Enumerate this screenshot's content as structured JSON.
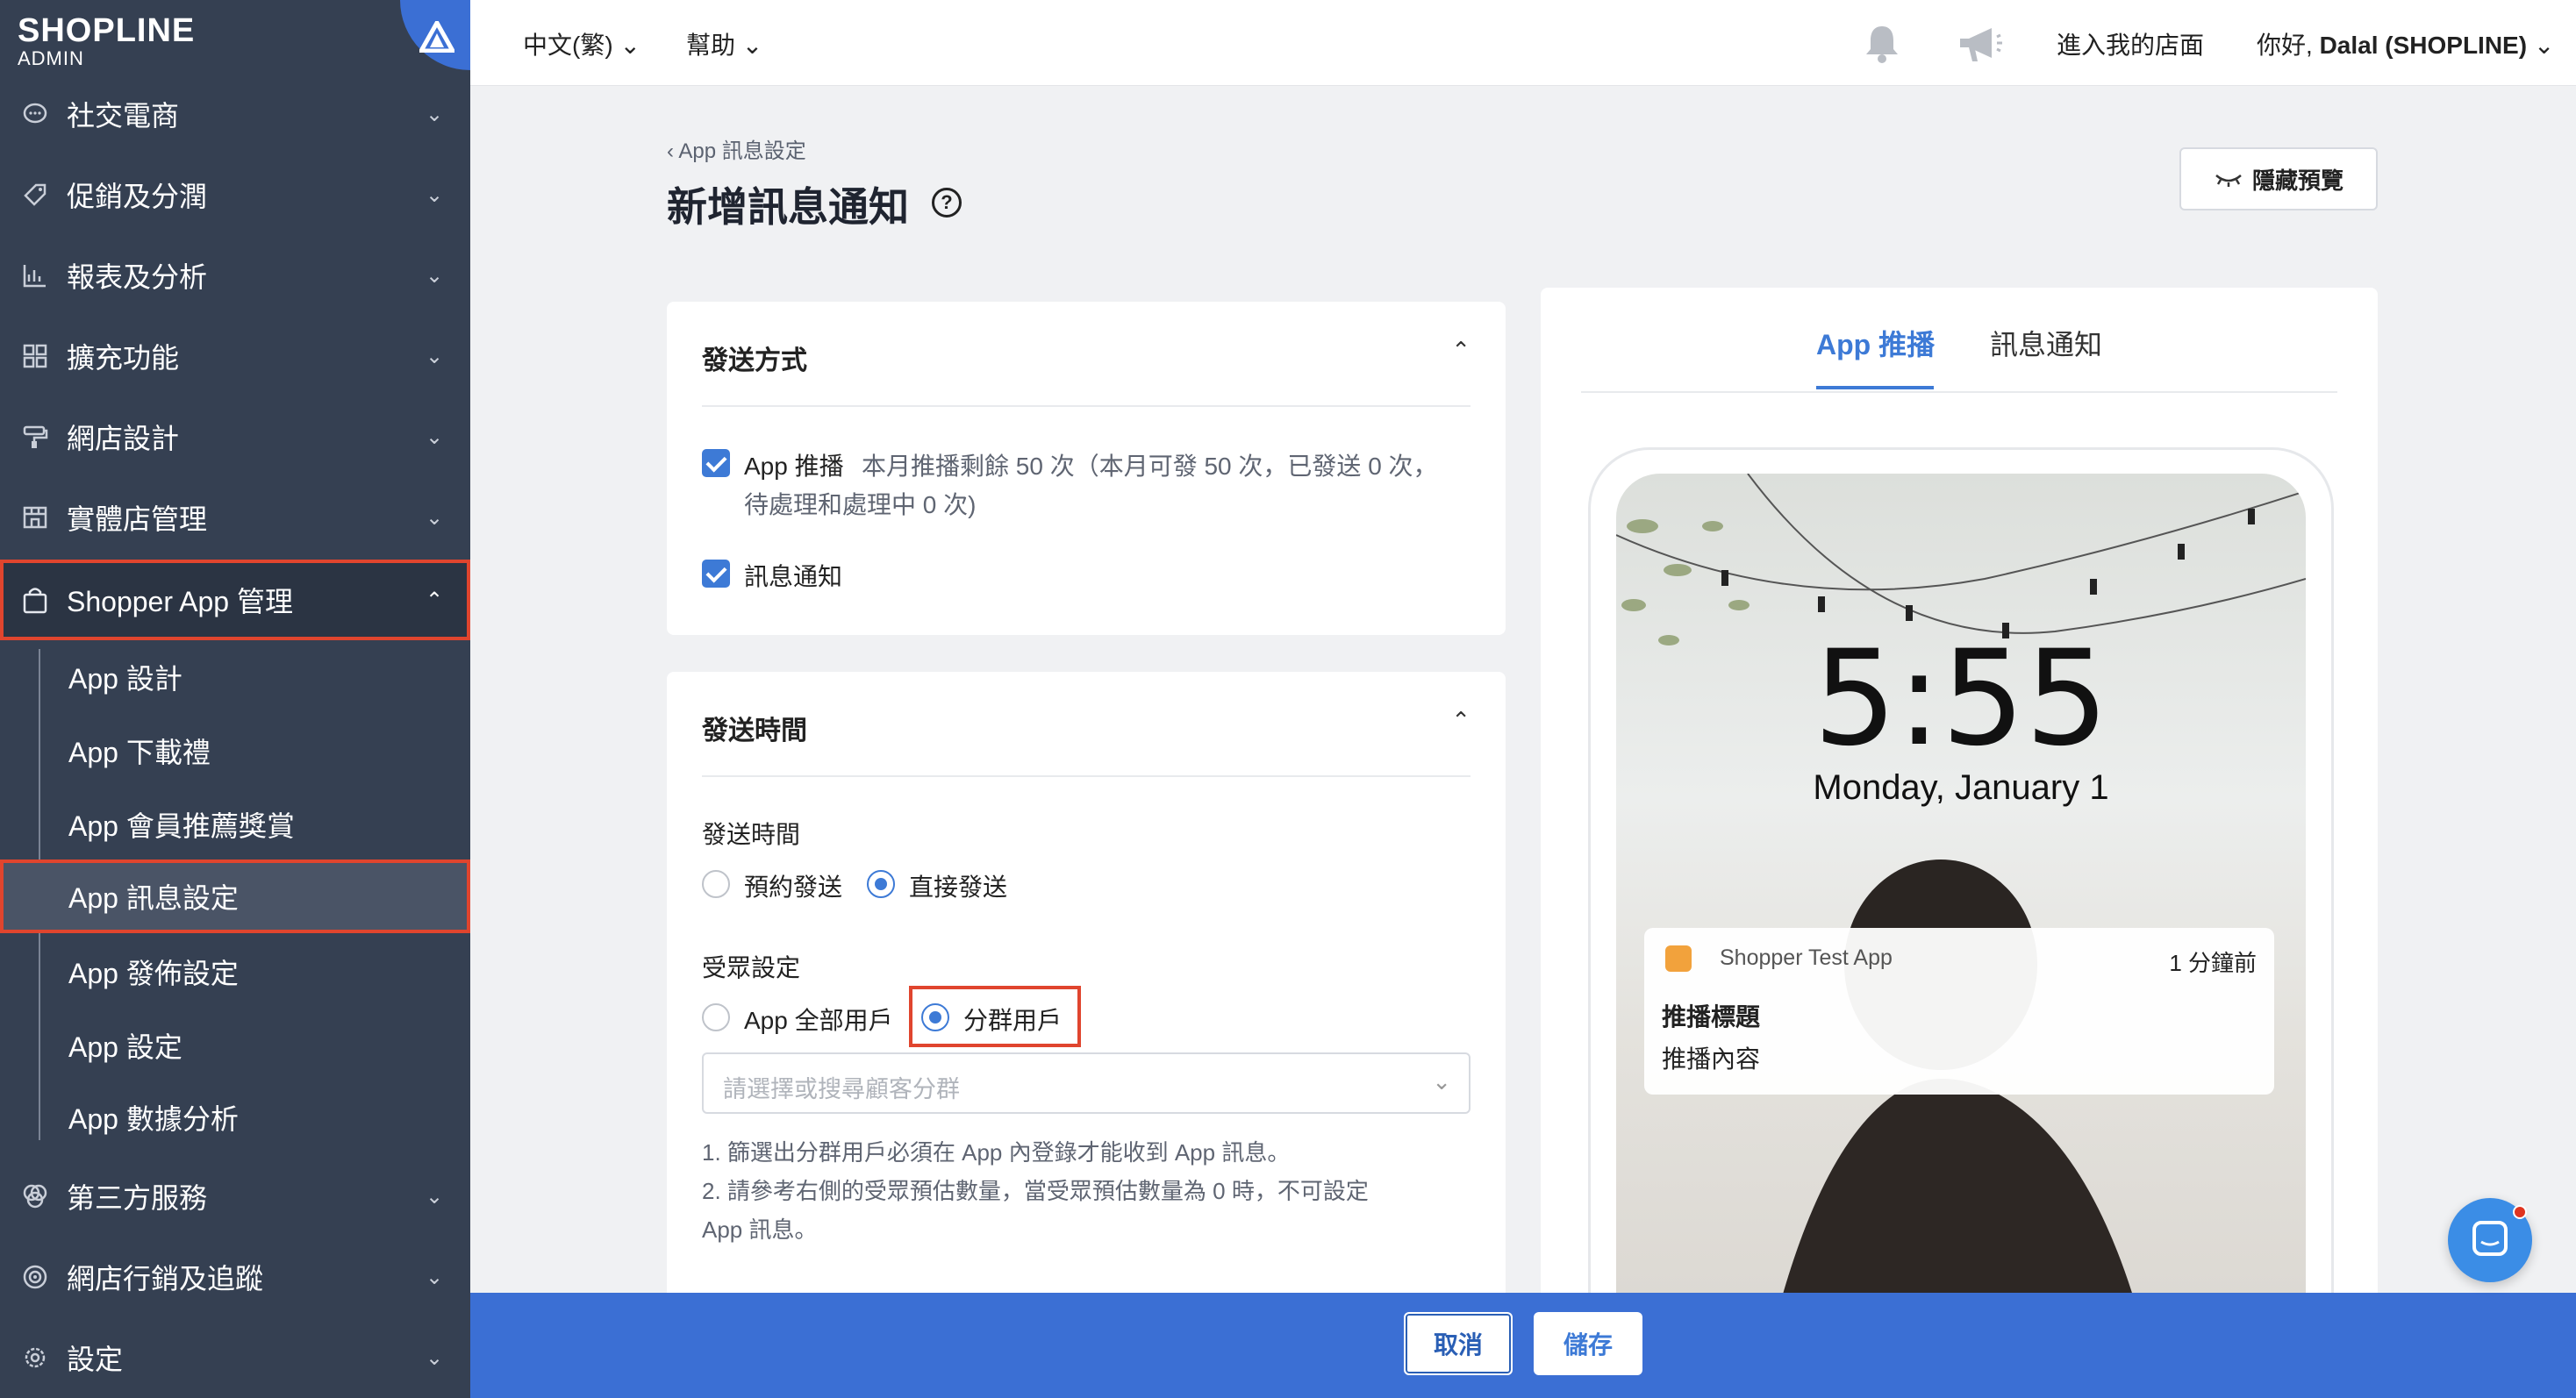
{
  "brand": {
    "logo": "SHOPLINE",
    "sub": "ADMIN"
  },
  "sidebar": {
    "items": [
      {
        "label": "社交電商",
        "icon": "chat-bubble-icon"
      },
      {
        "label": "促銷及分潤",
        "icon": "tag-icon"
      },
      {
        "label": "報表及分析",
        "icon": "chart-icon"
      },
      {
        "label": "擴充功能",
        "icon": "apps-grid-icon"
      },
      {
        "label": "網店設計",
        "icon": "paint-brush-icon"
      },
      {
        "label": "實體店管理",
        "icon": "store-icon"
      },
      {
        "label": "Shopper App 管理",
        "icon": "shopping-bag-icon"
      }
    ],
    "sub_items": [
      {
        "label": "App 設計"
      },
      {
        "label": "App 下載禮"
      },
      {
        "label": "App 會員推薦獎賞"
      },
      {
        "label": "App 訊息設定"
      },
      {
        "label": "App 發佈設定"
      },
      {
        "label": "App 設定"
      },
      {
        "label": "App 數據分析"
      }
    ],
    "bottom_items": [
      {
        "label": "第三方服務",
        "icon": "puzzle-icon"
      },
      {
        "label": "網店行銷及追蹤",
        "icon": "target-icon"
      },
      {
        "label": "設定",
        "icon": "gear-icon"
      }
    ]
  },
  "topbar": {
    "language": "中文(繁)",
    "help": "幫助",
    "enter_store": "進入我的店面",
    "greeting_prefix": "你好, ",
    "greeting_name": "Dalal (SHOPLINE)"
  },
  "page": {
    "breadcrumb": "App 訊息設定",
    "title": "新增訊息通知",
    "hide_preview": "隱藏預覽"
  },
  "send_method": {
    "title": "發送方式",
    "app_push_label": "App 推播",
    "app_push_note_1": "本月推播剩餘 50 次（本月可發 50 次，已發送 0 次，",
    "app_push_note_2": "待處理和處理中 0 次)",
    "message_label": "訊息通知"
  },
  "send_time": {
    "title": "發送時間",
    "time_label": "發送時間",
    "option_scheduled": "預約發送",
    "option_now": "直接發送",
    "audience_label": "受眾設定",
    "option_all_users": "App 全部用戶",
    "option_segment": "分群用戶",
    "segment_placeholder": "請選擇或搜尋顧客分群",
    "note_1": "1. 篩選出分群用戶必須在 App 內登錄才能收到 App 訊息。",
    "note_2": "2. 請參考右側的受眾預估數量，當受眾預估數量為 0 時，不可設定",
    "note_3": "App 訊息。"
  },
  "preview": {
    "tab_push": "App 推播",
    "tab_message": "訊息通知",
    "clock": "5:55",
    "date": "Monday, January 1",
    "notif_app": "Shopper Test App",
    "notif_time": "1 分鐘前",
    "notif_title": "推播標題",
    "notif_body": "推播內容"
  },
  "footer": {
    "cancel": "取消",
    "save": "儲存"
  },
  "colors": {
    "sidebar": "#354052",
    "accent": "#3d7ad6",
    "highlight": "#e0452e",
    "bottombar": "#3b6fd4"
  }
}
